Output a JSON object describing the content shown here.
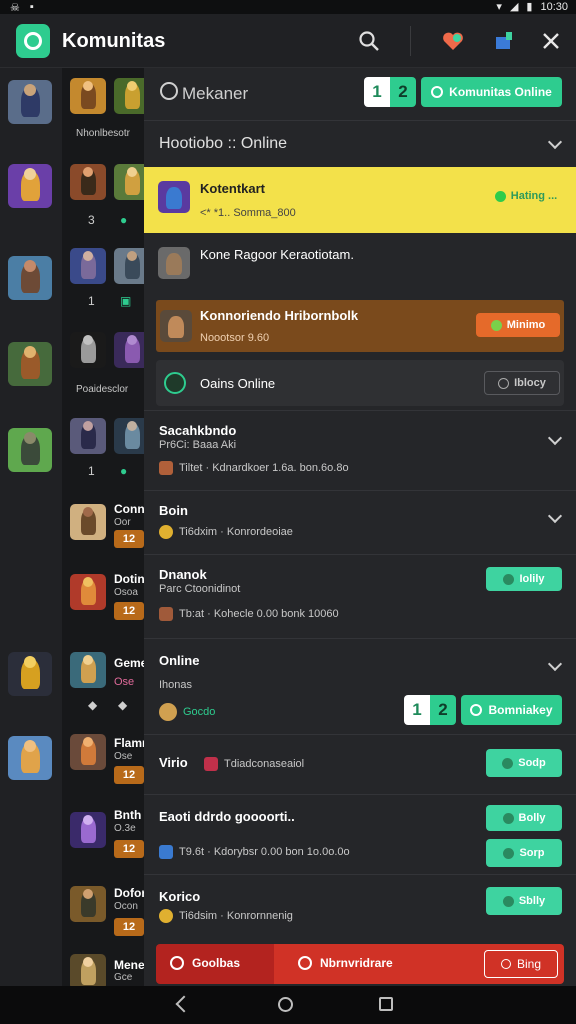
{
  "status": {
    "time": "10:30"
  },
  "app": {
    "title": "Komunitas"
  },
  "search": {
    "placeholder": "Mekaner"
  },
  "header_counts": {
    "left": "1",
    "right": "2"
  },
  "header_button": "Komunitas Online",
  "section_online": {
    "title": "Hootiobo :: Online"
  },
  "highlight_row": {
    "title": "Kotentkart",
    "subtitle": "<* *1.. Somma_800",
    "status": "Hating ..."
  },
  "row2": {
    "title": "Kone Ragoor Keraotiotam."
  },
  "orange_row": {
    "title": "Konnoriendo Hribornbolk",
    "subtitle": "Noootsor 9.60",
    "status": "Minimo"
  },
  "online_row": {
    "title": "Oains Online",
    "button": "Iblocy"
  },
  "items": [
    {
      "title": "Sacahkbndo",
      "subtitle_top": "Pr6Ci: Baaa Aki",
      "subtitle": "Tiltet ·  Kdnardkoer 1.6a. bon.6o.8o"
    },
    {
      "title": "Boin",
      "subtitle": "Ti6dxim ·  Konrordeoiae"
    },
    {
      "title": "Dnanok",
      "subtitle_top": "Parc Ctoonidinot",
      "subtitle": "Tb:at ·  Kohecle 0.00 bonk 10060",
      "button": "Iolily"
    },
    {
      "title": "Online",
      "subtitle_top": "Ihonas",
      "subtitle": "Gocdo",
      "counts_left": "1",
      "counts_right": "2",
      "button": "Bomniakey"
    },
    {
      "title": "Virio",
      "subtitle": "Tdiadconaseaiol",
      "button": "Sodp"
    },
    {
      "title": "Eaoti ddrdo goooorti..",
      "subtitle": "T9.6t ·  Kdorybsr 0.00 bon 1o.0o.0o",
      "button1": "Bolly",
      "button2": "Sorp"
    },
    {
      "title": "Korico",
      "subtitle": "Ti6dsim ·  Konrornnenig",
      "button": "Sblly"
    }
  ],
  "bottom_bar": {
    "left": "Goolbas",
    "center": "Nbrnvridrare",
    "right": "Bing"
  },
  "left_grid": {
    "col2_labels": [
      "Nhonlbesotr",
      "Poaidesclor"
    ],
    "counts": [
      "3",
      "1",
      "1"
    ],
    "names": [
      "Conn",
      "Dotin",
      "Geme",
      "Flamn",
      "Bnth",
      "Dofor",
      "Mene"
    ],
    "name_subs": [
      "Oor",
      "Osoa",
      "Ose",
      "Ose",
      "O.3e",
      "Ocon",
      "Gce"
    ],
    "badges": [
      "12",
      "12",
      "12",
      "12",
      "12"
    ]
  },
  "colors": {
    "accent": "#2ecc8f",
    "highlight": "#f3e14a",
    "danger": "#d03226"
  }
}
